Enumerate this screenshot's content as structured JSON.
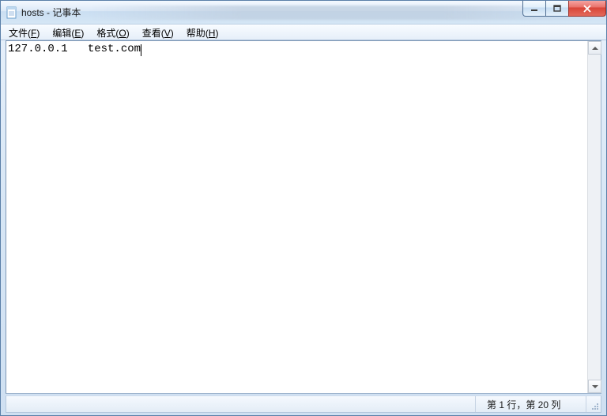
{
  "window": {
    "title": "hosts - 记事本"
  },
  "menu": {
    "file": {
      "label": "文件",
      "mnemonic": "F"
    },
    "edit": {
      "label": "编辑",
      "mnemonic": "E"
    },
    "format": {
      "label": "格式",
      "mnemonic": "O"
    },
    "view": {
      "label": "查看",
      "mnemonic": "V"
    },
    "help": {
      "label": "帮助",
      "mnemonic": "H"
    }
  },
  "editor": {
    "content": "127.0.0.1   test.com"
  },
  "status": {
    "position": "第 1 行，第 20 列"
  }
}
